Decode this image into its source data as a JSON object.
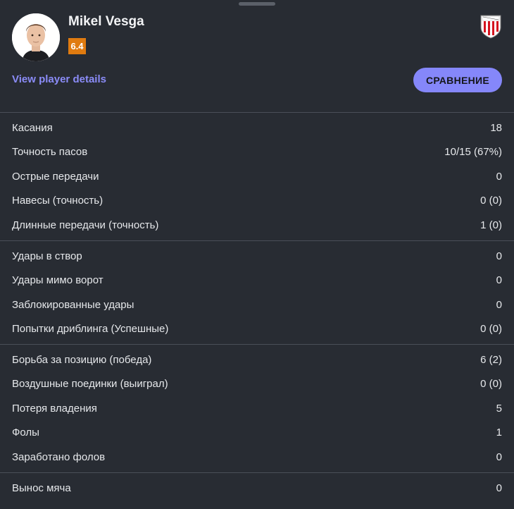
{
  "player": {
    "name": "Mikel Vesga",
    "rating": "6.4",
    "details_link": "View player details",
    "compare_button": "СРАВНЕНИЕ"
  },
  "colors": {
    "background": "#282c33",
    "accent": "#8587fa",
    "rating_badge": "#e07b10",
    "divider": "#4a4f58"
  },
  "icons": {
    "club_crest": "athletic-bilbao-crest-icon",
    "avatar": "player-photo"
  },
  "stat_groups": [
    [
      {
        "label": "Касания",
        "value": "18"
      },
      {
        "label": "Точность пасов",
        "value": "10/15 (67%)"
      },
      {
        "label": "Острые передачи",
        "value": "0"
      },
      {
        "label": "Навесы (точность)",
        "value": "0 (0)"
      },
      {
        "label": "Длинные передачи (точность)",
        "value": "1 (0)"
      }
    ],
    [
      {
        "label": "Удары в створ",
        "value": "0"
      },
      {
        "label": "Удары мимо ворот",
        "value": "0"
      },
      {
        "label": "Заблокированные удары",
        "value": "0"
      },
      {
        "label": "Попытки дриблинга (Успешные)",
        "value": "0 (0)"
      }
    ],
    [
      {
        "label": "Борьба за позицию (победа)",
        "value": "6 (2)"
      },
      {
        "label": "Воздушные поединки (выиграл)",
        "value": "0 (0)"
      },
      {
        "label": "Потеря владения",
        "value": "5"
      },
      {
        "label": "Фолы",
        "value": "1"
      },
      {
        "label": "Заработано фолов",
        "value": "0"
      }
    ],
    [
      {
        "label": "Вынос мяча",
        "value": "0"
      }
    ]
  ]
}
